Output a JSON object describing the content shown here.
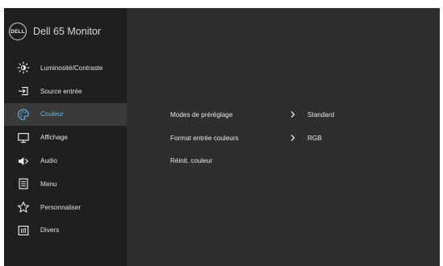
{
  "window": {
    "logo_text": "DELL",
    "title": "Dell 65 Monitor"
  },
  "menu": {
    "items": [
      {
        "label": "Luminosité/Contraste",
        "icon": "brightness-icon"
      },
      {
        "label": "Source entrée",
        "icon": "input-source-icon"
      },
      {
        "label": "Couleur",
        "icon": "palette-icon",
        "active": true
      },
      {
        "label": "Affichage",
        "icon": "display-icon"
      },
      {
        "label": "Audio",
        "icon": "speaker-icon"
      },
      {
        "label": "Menu",
        "icon": "menu-icon"
      },
      {
        "label": "Personnaliser",
        "icon": "star-icon"
      },
      {
        "label": "Divers",
        "icon": "info-icon"
      }
    ]
  },
  "submenu": {
    "rows": [
      {
        "label": "Modes de préréglage",
        "value": "Standard",
        "has_submenu": true
      },
      {
        "label": "Format entrée couleurs",
        "value": "RGB",
        "has_submenu": true
      },
      {
        "label": "Réinit. couleur",
        "value": "",
        "has_submenu": false
      }
    ]
  },
  "colors": {
    "sidebar_bg": "#1f1f1f",
    "main_bg": "#2e2e2e",
    "active_row_bg": "#3a3a3a",
    "accent": "#62b6ea"
  }
}
